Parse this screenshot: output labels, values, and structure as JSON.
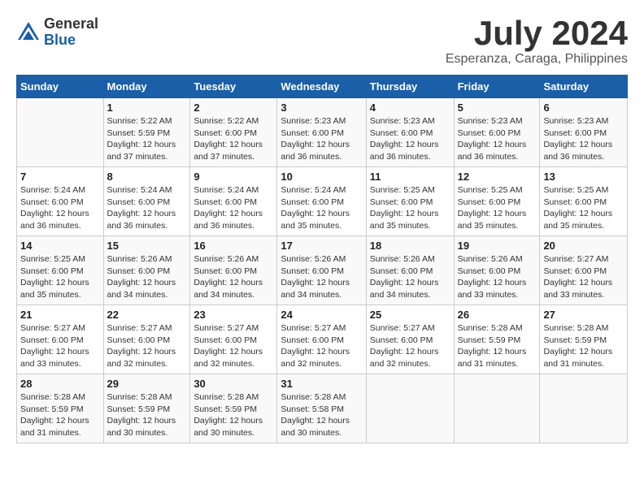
{
  "header": {
    "logo_general": "General",
    "logo_blue": "Blue",
    "month": "July 2024",
    "location": "Esperanza, Caraga, Philippines"
  },
  "days_of_week": [
    "Sunday",
    "Monday",
    "Tuesday",
    "Wednesday",
    "Thursday",
    "Friday",
    "Saturday"
  ],
  "weeks": [
    [
      {
        "day": "",
        "sunrise": "",
        "sunset": "",
        "daylight": ""
      },
      {
        "day": "1",
        "sunrise": "Sunrise: 5:22 AM",
        "sunset": "Sunset: 5:59 PM",
        "daylight": "Daylight: 12 hours and 37 minutes."
      },
      {
        "day": "2",
        "sunrise": "Sunrise: 5:22 AM",
        "sunset": "Sunset: 6:00 PM",
        "daylight": "Daylight: 12 hours and 37 minutes."
      },
      {
        "day": "3",
        "sunrise": "Sunrise: 5:23 AM",
        "sunset": "Sunset: 6:00 PM",
        "daylight": "Daylight: 12 hours and 36 minutes."
      },
      {
        "day": "4",
        "sunrise": "Sunrise: 5:23 AM",
        "sunset": "Sunset: 6:00 PM",
        "daylight": "Daylight: 12 hours and 36 minutes."
      },
      {
        "day": "5",
        "sunrise": "Sunrise: 5:23 AM",
        "sunset": "Sunset: 6:00 PM",
        "daylight": "Daylight: 12 hours and 36 minutes."
      },
      {
        "day": "6",
        "sunrise": "Sunrise: 5:23 AM",
        "sunset": "Sunset: 6:00 PM",
        "daylight": "Daylight: 12 hours and 36 minutes."
      }
    ],
    [
      {
        "day": "7",
        "sunrise": "Sunrise: 5:24 AM",
        "sunset": "Sunset: 6:00 PM",
        "daylight": "Daylight: 12 hours and 36 minutes."
      },
      {
        "day": "8",
        "sunrise": "Sunrise: 5:24 AM",
        "sunset": "Sunset: 6:00 PM",
        "daylight": "Daylight: 12 hours and 36 minutes."
      },
      {
        "day": "9",
        "sunrise": "Sunrise: 5:24 AM",
        "sunset": "Sunset: 6:00 PM",
        "daylight": "Daylight: 12 hours and 36 minutes."
      },
      {
        "day": "10",
        "sunrise": "Sunrise: 5:24 AM",
        "sunset": "Sunset: 6:00 PM",
        "daylight": "Daylight: 12 hours and 35 minutes."
      },
      {
        "day": "11",
        "sunrise": "Sunrise: 5:25 AM",
        "sunset": "Sunset: 6:00 PM",
        "daylight": "Daylight: 12 hours and 35 minutes."
      },
      {
        "day": "12",
        "sunrise": "Sunrise: 5:25 AM",
        "sunset": "Sunset: 6:00 PM",
        "daylight": "Daylight: 12 hours and 35 minutes."
      },
      {
        "day": "13",
        "sunrise": "Sunrise: 5:25 AM",
        "sunset": "Sunset: 6:00 PM",
        "daylight": "Daylight: 12 hours and 35 minutes."
      }
    ],
    [
      {
        "day": "14",
        "sunrise": "Sunrise: 5:25 AM",
        "sunset": "Sunset: 6:00 PM",
        "daylight": "Daylight: 12 hours and 35 minutes."
      },
      {
        "day": "15",
        "sunrise": "Sunrise: 5:26 AM",
        "sunset": "Sunset: 6:00 PM",
        "daylight": "Daylight: 12 hours and 34 minutes."
      },
      {
        "day": "16",
        "sunrise": "Sunrise: 5:26 AM",
        "sunset": "Sunset: 6:00 PM",
        "daylight": "Daylight: 12 hours and 34 minutes."
      },
      {
        "day": "17",
        "sunrise": "Sunrise: 5:26 AM",
        "sunset": "Sunset: 6:00 PM",
        "daylight": "Daylight: 12 hours and 34 minutes."
      },
      {
        "day": "18",
        "sunrise": "Sunrise: 5:26 AM",
        "sunset": "Sunset: 6:00 PM",
        "daylight": "Daylight: 12 hours and 34 minutes."
      },
      {
        "day": "19",
        "sunrise": "Sunrise: 5:26 AM",
        "sunset": "Sunset: 6:00 PM",
        "daylight": "Daylight: 12 hours and 33 minutes."
      },
      {
        "day": "20",
        "sunrise": "Sunrise: 5:27 AM",
        "sunset": "Sunset: 6:00 PM",
        "daylight": "Daylight: 12 hours and 33 minutes."
      }
    ],
    [
      {
        "day": "21",
        "sunrise": "Sunrise: 5:27 AM",
        "sunset": "Sunset: 6:00 PM",
        "daylight": "Daylight: 12 hours and 33 minutes."
      },
      {
        "day": "22",
        "sunrise": "Sunrise: 5:27 AM",
        "sunset": "Sunset: 6:00 PM",
        "daylight": "Daylight: 12 hours and 32 minutes."
      },
      {
        "day": "23",
        "sunrise": "Sunrise: 5:27 AM",
        "sunset": "Sunset: 6:00 PM",
        "daylight": "Daylight: 12 hours and 32 minutes."
      },
      {
        "day": "24",
        "sunrise": "Sunrise: 5:27 AM",
        "sunset": "Sunset: 6:00 PM",
        "daylight": "Daylight: 12 hours and 32 minutes."
      },
      {
        "day": "25",
        "sunrise": "Sunrise: 5:27 AM",
        "sunset": "Sunset: 6:00 PM",
        "daylight": "Daylight: 12 hours and 32 minutes."
      },
      {
        "day": "26",
        "sunrise": "Sunrise: 5:28 AM",
        "sunset": "Sunset: 5:59 PM",
        "daylight": "Daylight: 12 hours and 31 minutes."
      },
      {
        "day": "27",
        "sunrise": "Sunrise: 5:28 AM",
        "sunset": "Sunset: 5:59 PM",
        "daylight": "Daylight: 12 hours and 31 minutes."
      }
    ],
    [
      {
        "day": "28",
        "sunrise": "Sunrise: 5:28 AM",
        "sunset": "Sunset: 5:59 PM",
        "daylight": "Daylight: 12 hours and 31 minutes."
      },
      {
        "day": "29",
        "sunrise": "Sunrise: 5:28 AM",
        "sunset": "Sunset: 5:59 PM",
        "daylight": "Daylight: 12 hours and 30 minutes."
      },
      {
        "day": "30",
        "sunrise": "Sunrise: 5:28 AM",
        "sunset": "Sunset: 5:59 PM",
        "daylight": "Daylight: 12 hours and 30 minutes."
      },
      {
        "day": "31",
        "sunrise": "Sunrise: 5:28 AM",
        "sunset": "Sunset: 5:58 PM",
        "daylight": "Daylight: 12 hours and 30 minutes."
      },
      {
        "day": "",
        "sunrise": "",
        "sunset": "",
        "daylight": ""
      },
      {
        "day": "",
        "sunrise": "",
        "sunset": "",
        "daylight": ""
      },
      {
        "day": "",
        "sunrise": "",
        "sunset": "",
        "daylight": ""
      }
    ]
  ]
}
